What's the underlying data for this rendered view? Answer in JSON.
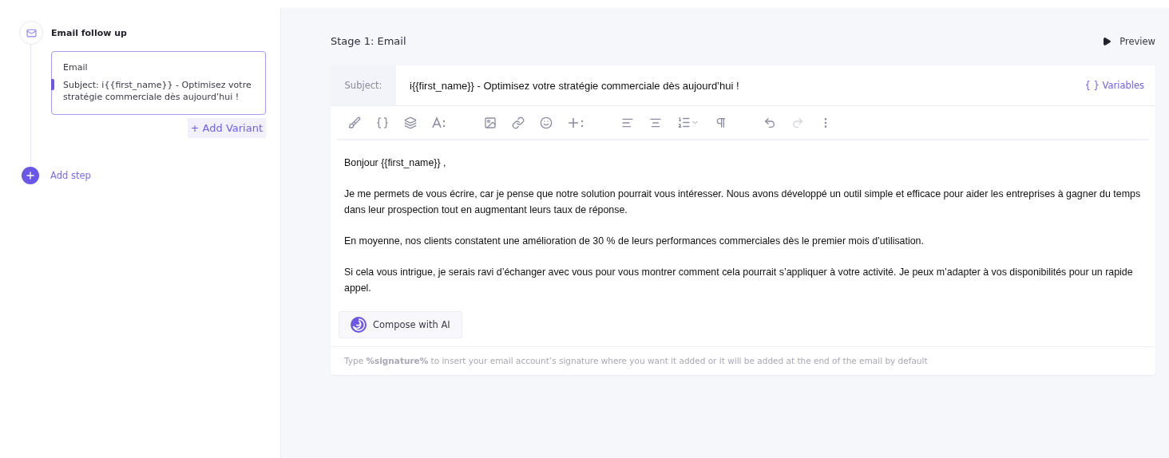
{
  "sequence": {
    "step_title": "Email follow up",
    "variant": {
      "label": "Email",
      "subject": "Subject: i{{first_name}} - Optimisez votre stratégie commerciale dès aujourd’hui !",
      "selected": true
    },
    "add_variant": "+ Add Variant",
    "add_step": "Add step"
  },
  "stage": {
    "title": "Stage 1: Email",
    "preview": "Preview"
  },
  "editor": {
    "subject_label": "Subject:",
    "subject_value": "i{{first_name}} - Optimisez votre stratégie commerciale dès aujourd’hui !",
    "variables": "{ } Variables",
    "toolbar": [
      [
        {
          "kind": "brush"
        },
        {
          "kind": "braces"
        },
        {
          "kind": "layers"
        },
        {
          "kind": "font-size"
        }
      ],
      [
        {
          "kind": "image"
        },
        {
          "kind": "link"
        },
        {
          "kind": "emoji"
        },
        {
          "kind": "insert"
        }
      ],
      [
        {
          "kind": "align-left"
        },
        {
          "kind": "align-center"
        },
        {
          "kind": "ordered-list"
        },
        {
          "kind": "paragraph"
        }
      ],
      [
        {
          "kind": "undo",
          "disabled": false
        },
        {
          "kind": "redo",
          "disabled": true
        },
        {
          "kind": "more"
        }
      ]
    ],
    "paragraphs": [
      "Bonjour {{first_name}} ,",
      "Je me permets de vous écrire, car je pense que notre solution pourrait vous intéresser. Nous avons développé un outil simple et efficace pour aider les entreprises à gagner du temps dans leur prospection tout en augmentant leurs taux de réponse.",
      "En moyenne, nos clients constatent une amélioration de 30 % de leurs performances commerciales dès le premier mois d’utilisation.",
      "Si cela vous intrigue, je serais ravi d’échanger avec vous pour vous montrer comment cela pourrait s’appliquer à votre activité. Je peux m’adapter à vos disponibilités pour un rapide appel."
    ],
    "compose_button": "Compose with AI",
    "signature_hint": "Type **%signature%** to insert your email account’s signature where you want it added or it will be added at the end of the email by default"
  }
}
